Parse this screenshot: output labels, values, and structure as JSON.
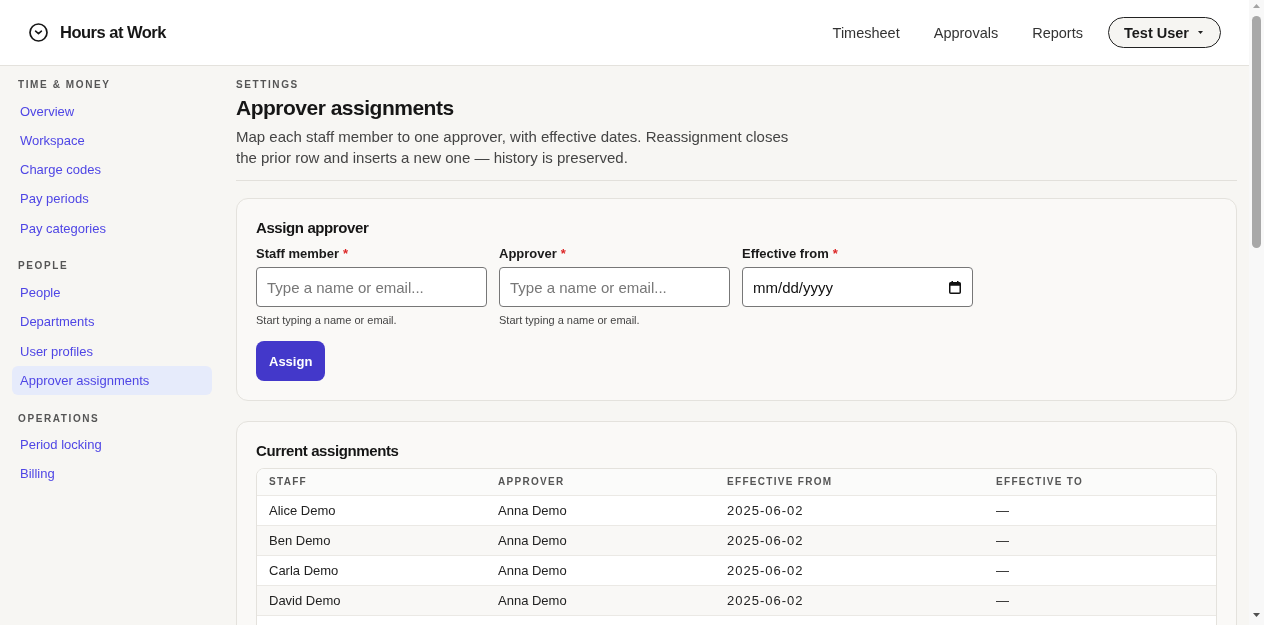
{
  "header": {
    "app_name": "Hours at Work",
    "nav": [
      {
        "label": "Timesheet"
      },
      {
        "label": "Approvals"
      },
      {
        "label": "Reports"
      }
    ],
    "user_menu": {
      "label": "Test User"
    }
  },
  "sidebar": {
    "sections": [
      {
        "title": "TIME & MONEY",
        "items": [
          {
            "label": "Overview",
            "selected": false
          },
          {
            "label": "Workspace",
            "selected": false
          },
          {
            "label": "Charge codes",
            "selected": false
          },
          {
            "label": "Pay periods",
            "selected": false
          },
          {
            "label": "Pay categories",
            "selected": false
          }
        ]
      },
      {
        "title": "PEOPLE",
        "items": [
          {
            "label": "People",
            "selected": false
          },
          {
            "label": "Departments",
            "selected": false
          },
          {
            "label": "User profiles",
            "selected": false
          },
          {
            "label": "Approver assignments",
            "selected": true
          }
        ]
      },
      {
        "title": "OPERATIONS",
        "items": [
          {
            "label": "Period locking",
            "selected": false
          },
          {
            "label": "Billing",
            "selected": false
          }
        ]
      }
    ]
  },
  "page": {
    "eyebrow": "SETTINGS",
    "title": "Approver assignments",
    "description": "Map each staff member to one approver, with effective dates. Reassignment closes the prior row and inserts a new one — history is preserved."
  },
  "assign_form": {
    "title": "Assign approver",
    "required_mark": "*",
    "fields": [
      {
        "kind": "text",
        "label": "Staff member",
        "required": true,
        "placeholder": "Type a name or email...",
        "help": "Start typing a name or email."
      },
      {
        "kind": "text",
        "label": "Approver",
        "required": true,
        "placeholder": "Type a name or email...",
        "help": "Start typing a name or email."
      },
      {
        "kind": "date",
        "label": "Effective from",
        "required": true,
        "placeholder": "mm/dd/yyyy"
      }
    ],
    "submit": "Assign"
  },
  "assignments": {
    "title": "Current assignments",
    "columns": [
      "STAFF",
      "APPROVER",
      "EFFECTIVE FROM",
      "EFFECTIVE TO"
    ],
    "rows": [
      [
        "Alice Demo",
        "Anna Demo",
        "2025-06-02",
        "—"
      ],
      [
        "Ben Demo",
        "Anna Demo",
        "2025-06-02",
        "—"
      ],
      [
        "Carla Demo",
        "Anna Demo",
        "2025-06-02",
        "—"
      ],
      [
        "David Demo",
        "Anna Demo",
        "2025-06-02",
        "—"
      ]
    ]
  }
}
